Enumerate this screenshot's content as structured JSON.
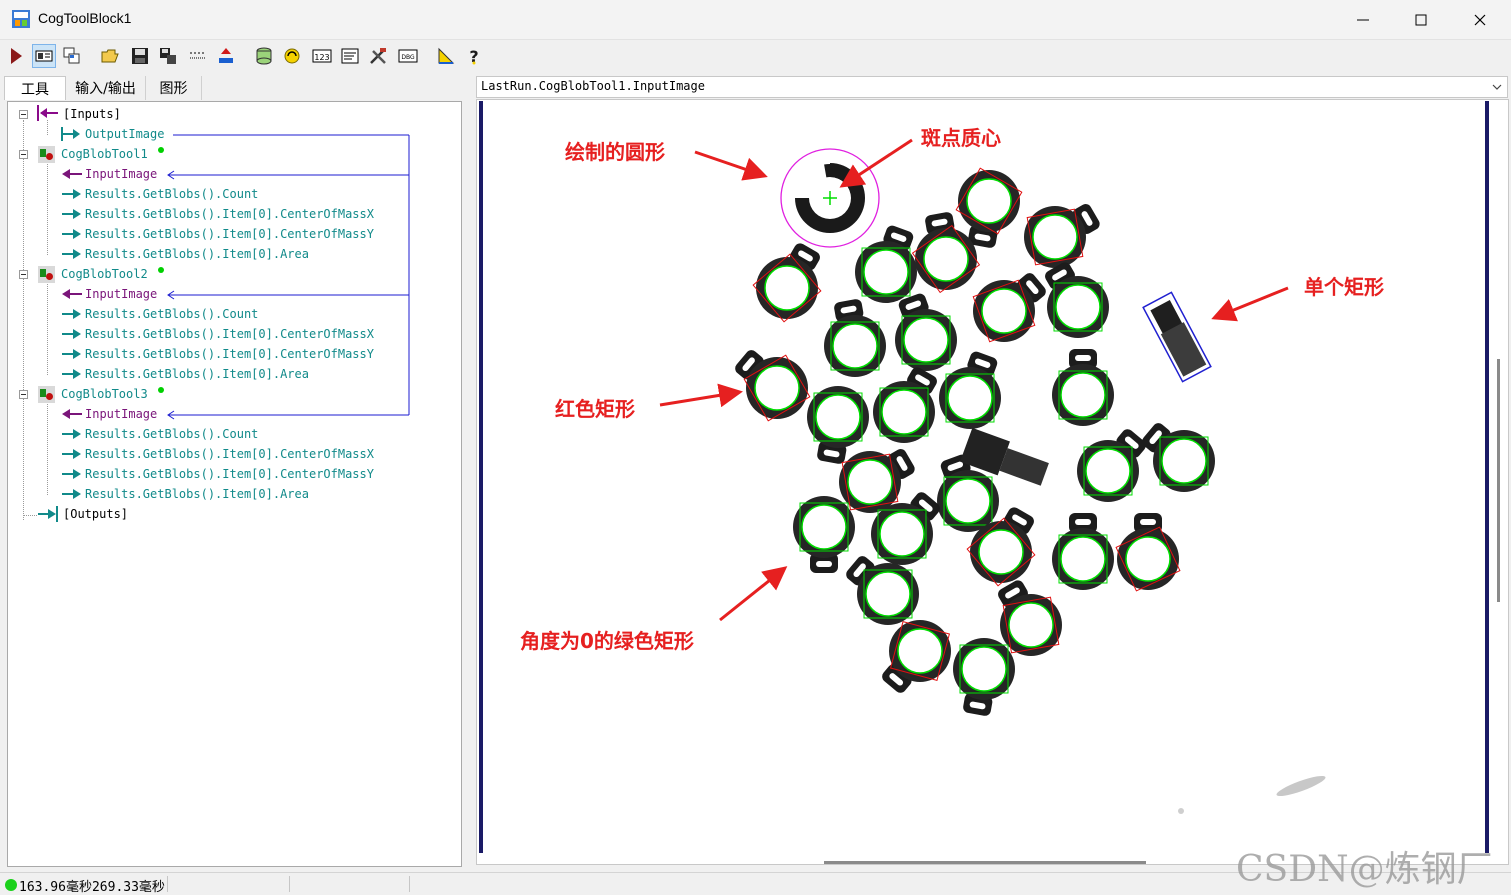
{
  "window": {
    "title": "CogToolBlock1",
    "controls": [
      "minimize",
      "maximize",
      "close"
    ]
  },
  "toolbar": {
    "buttons": [
      "run-icon",
      "show-tool-icon",
      "windows-icon",
      "open-icon",
      "save-icon",
      "save-settings-icon",
      "dotted-line-icon",
      "reset-icon",
      "database-icon",
      "refresh-icon",
      "numeric-icon",
      "edit-script-icon",
      "tools-icon",
      "debug-icon",
      "measure-icon",
      "help-icon"
    ]
  },
  "left_panel": {
    "tabs": [
      "工具",
      "输入/输出",
      "图形"
    ],
    "tree": {
      "inputs": "[Inputs]",
      "output_image": "OutputImage",
      "tools": [
        {
          "name": "CogBlobTool1",
          "input": "InputImage",
          "outputs": [
            "Results.GetBlobs().Count",
            "Results.GetBlobs().Item[0].CenterOfMassX",
            "Results.GetBlobs().Item[0].CenterOfMassY",
            "Results.GetBlobs().Item[0].Area"
          ]
        },
        {
          "name": "CogBlobTool2",
          "input": "InputImage",
          "outputs": [
            "Results.GetBlobs().Count",
            "Results.GetBlobs().Item[0].CenterOfMassX",
            "Results.GetBlobs().Item[0].CenterOfMassY",
            "Results.GetBlobs().Item[0].Area"
          ]
        },
        {
          "name": "CogBlobTool3",
          "input": "InputImage",
          "outputs": [
            "Results.GetBlobs().Count",
            "Results.GetBlobs().Item[0].CenterOfMassX",
            "Results.GetBlobs().Item[0].CenterOfMassY",
            "Results.GetBlobs().Item[0].Area"
          ]
        }
      ],
      "outputs": "[Outputs]"
    }
  },
  "display": {
    "image_path": "LastRun.CogBlobTool1.InputImage",
    "annotations": {
      "circle": "绘制的圆形",
      "centroid": "斑点质心",
      "single_rect": "单个矩形",
      "red_rect": "红色矩形",
      "green_rect": "角度为0的绿色矩形"
    },
    "colors": {
      "annotation": "#e62020",
      "green_box": "#00dd00",
      "red_box": "#e01010",
      "magenta_circle": "#e020e0",
      "blue_rect": "#2020d0"
    }
  },
  "status": {
    "text": "163.96毫秒269.33毫秒",
    "indicator_color": "#1bd11b"
  },
  "watermark": "CSDN@炼钢厂"
}
